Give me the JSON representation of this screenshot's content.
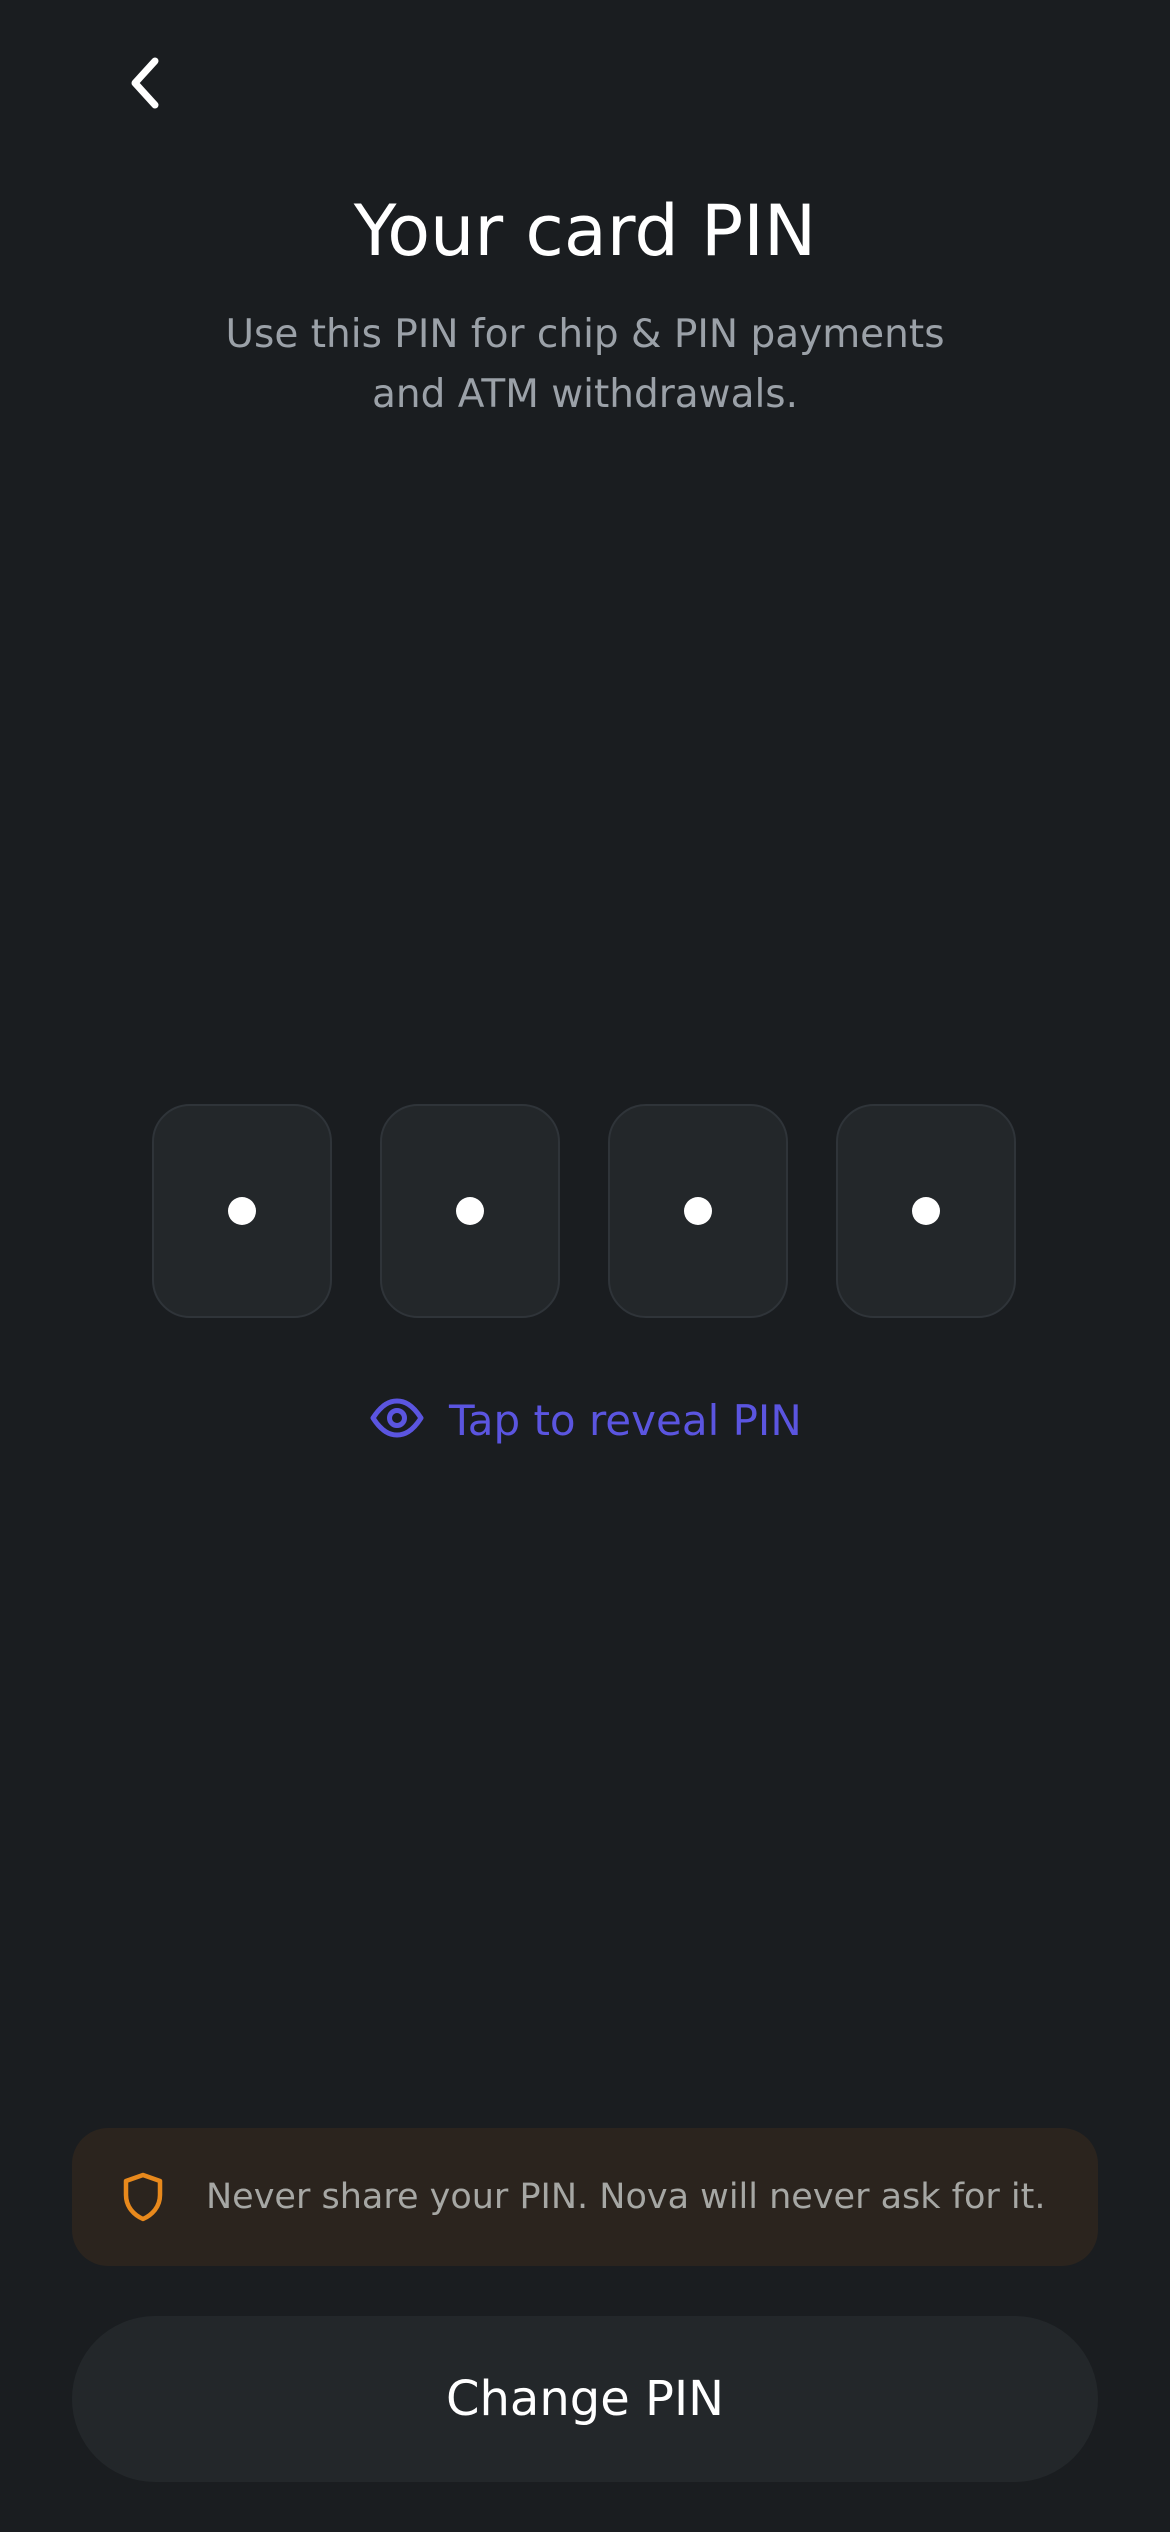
{
  "header": {
    "back_icon": "chevron-left-icon"
  },
  "title": "Your card PIN",
  "subtitle": "Use this PIN for chip & PIN payments and ATM withdrawals.",
  "pin": {
    "length": 4,
    "masked": true
  },
  "reveal": {
    "label": "Tap to reveal PIN",
    "icon": "eye-icon",
    "color": "#5b55e0"
  },
  "warning": {
    "icon": "shield-icon",
    "text": "Never share your PIN. Nova will never ask for it.",
    "icon_color": "#e8891c",
    "background": "#2b241e"
  },
  "primary_action": {
    "label": "Change PIN"
  },
  "colors": {
    "background": "#1a1d20",
    "surface": "#23272a",
    "text_primary": "#ffffff",
    "text_secondary": "#9ba1a8"
  }
}
